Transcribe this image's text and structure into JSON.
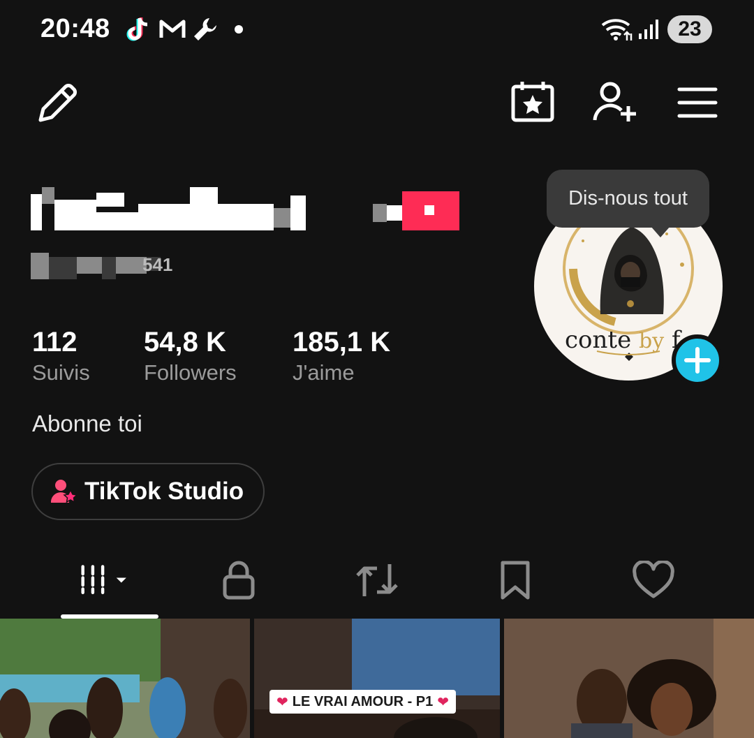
{
  "status_bar": {
    "time": "20:48",
    "battery": "23",
    "icons": [
      "tiktok-icon",
      "gmail-icon",
      "wrench-icon",
      "wifi-icon",
      "signal-icon"
    ]
  },
  "top_bar": {
    "icons": [
      "edit-pencil-icon",
      "calendar-star-icon",
      "add-friend-icon",
      "menu-icon"
    ]
  },
  "profile": {
    "name_visible_part": "bara",
    "handle_visible_part": "541"
  },
  "tooltip": {
    "text": "Dis-nous tout"
  },
  "avatar": {
    "text_main": "conte ",
    "text_by": "by",
    "text_tail": " f"
  },
  "stats": [
    {
      "value": "112",
      "label": "Suivis"
    },
    {
      "value": "54,8 K",
      "label": "Followers"
    },
    {
      "value": "185,1 K",
      "label": "J'aime"
    }
  ],
  "bio": "Abonne toi",
  "studio_button": {
    "label": "TikTok Studio"
  },
  "tabs": [
    {
      "name": "videos",
      "icon": "grid-icon",
      "active": true
    },
    {
      "name": "private",
      "icon": "lock-icon"
    },
    {
      "name": "reposts",
      "icon": "repost-icon"
    },
    {
      "name": "favorites",
      "icon": "bookmark-icon"
    },
    {
      "name": "liked",
      "icon": "heart-icon"
    }
  ],
  "videos": [
    {
      "caption": ""
    },
    {
      "caption": "LE VRAI AMOUR - P1"
    },
    {
      "caption": ""
    }
  ],
  "colors": {
    "background": "#121212",
    "accent_red": "#fe2c55",
    "accent_cyan": "#20c3e8",
    "muted_text": "#9b9b9b"
  }
}
